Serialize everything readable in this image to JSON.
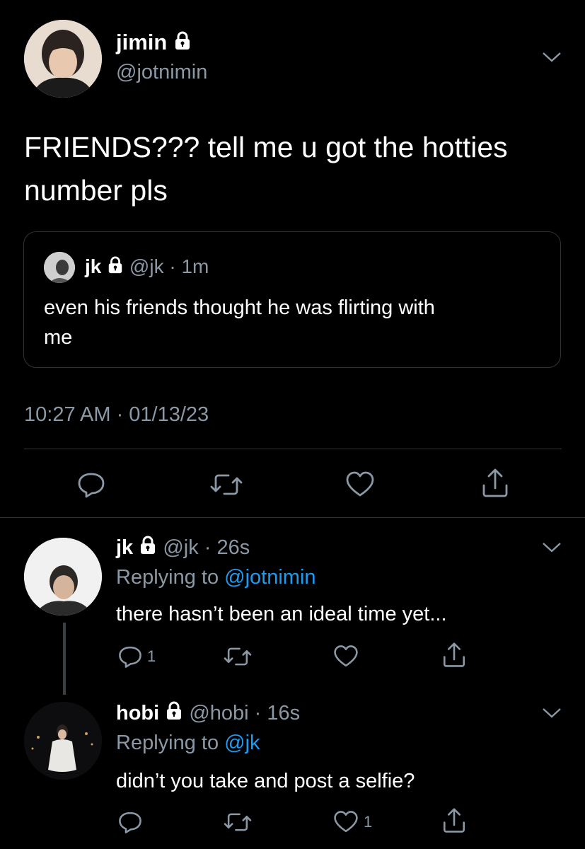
{
  "main_tweet": {
    "display_name": "jimin",
    "handle": "@jotnimin",
    "text_line1": "FRIENDS??? tell me u got the hotties",
    "text_line2": "number pls",
    "timestamp": "10:27 AM · 01/13/23",
    "quoted": {
      "display_name": "jk",
      "handle": "@jk",
      "time": "· 1m",
      "text_line1": "even his friends thought he was flirting with",
      "text_line2": "me"
    }
  },
  "replies": [
    {
      "display_name": "jk",
      "handle": "@jk",
      "time": "· 26s",
      "replying_prefix": "Replying to ",
      "replying_to": "@jotnimin",
      "text": "there hasn’t been an ideal time yet...",
      "reply_count": "1",
      "like_count": ""
    },
    {
      "display_name": "hobi",
      "handle": "@hobi",
      "time": "· 16s",
      "replying_prefix": "Replying to ",
      "replying_to": "@jk",
      "text": "didn’t you take and post a selfie?",
      "reply_count": "",
      "like_count": "1"
    }
  ],
  "icons": {
    "reply": "reply-icon",
    "retweet": "retweet-icon",
    "like": "heart-icon",
    "share": "share-icon",
    "lock": "lock-icon",
    "more": "chevron-down-icon"
  },
  "colors": {
    "background": "#000000",
    "secondary_text": "#8b98a5",
    "link": "#1d9bf0",
    "divider": "#2f3336"
  }
}
